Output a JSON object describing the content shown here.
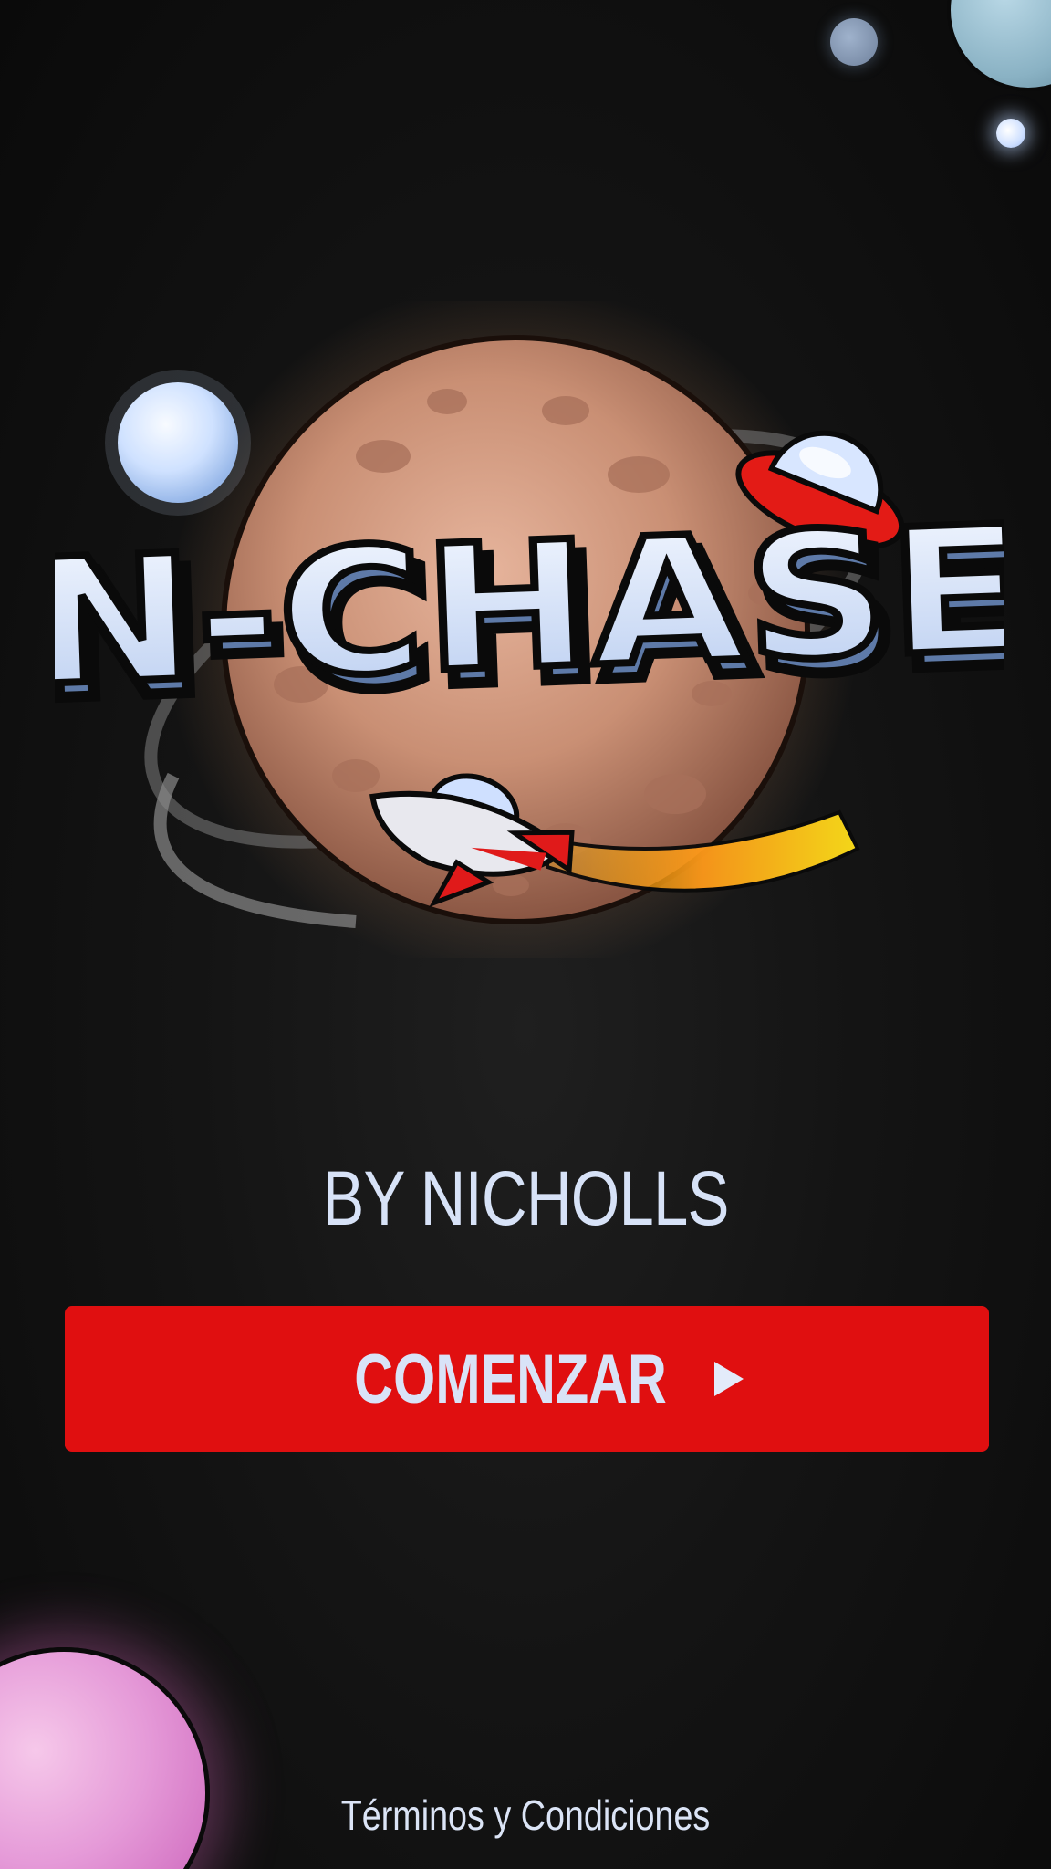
{
  "game": {
    "logo_text": "ION-CHASER!",
    "byline": "BY NICHOLLS",
    "start_button_label": "COMENZAR",
    "start_icon": "play-icon",
    "terms_link": "Términos y Condiciones"
  },
  "colors": {
    "background": "#111111",
    "button": "#e00f10",
    "text": "#d7e2f7",
    "planet_main": "#c98f74",
    "pink_planet": "#e59ad8",
    "logo_letters": "#dce7fb",
    "logo_outline": "#0a0a0a"
  }
}
